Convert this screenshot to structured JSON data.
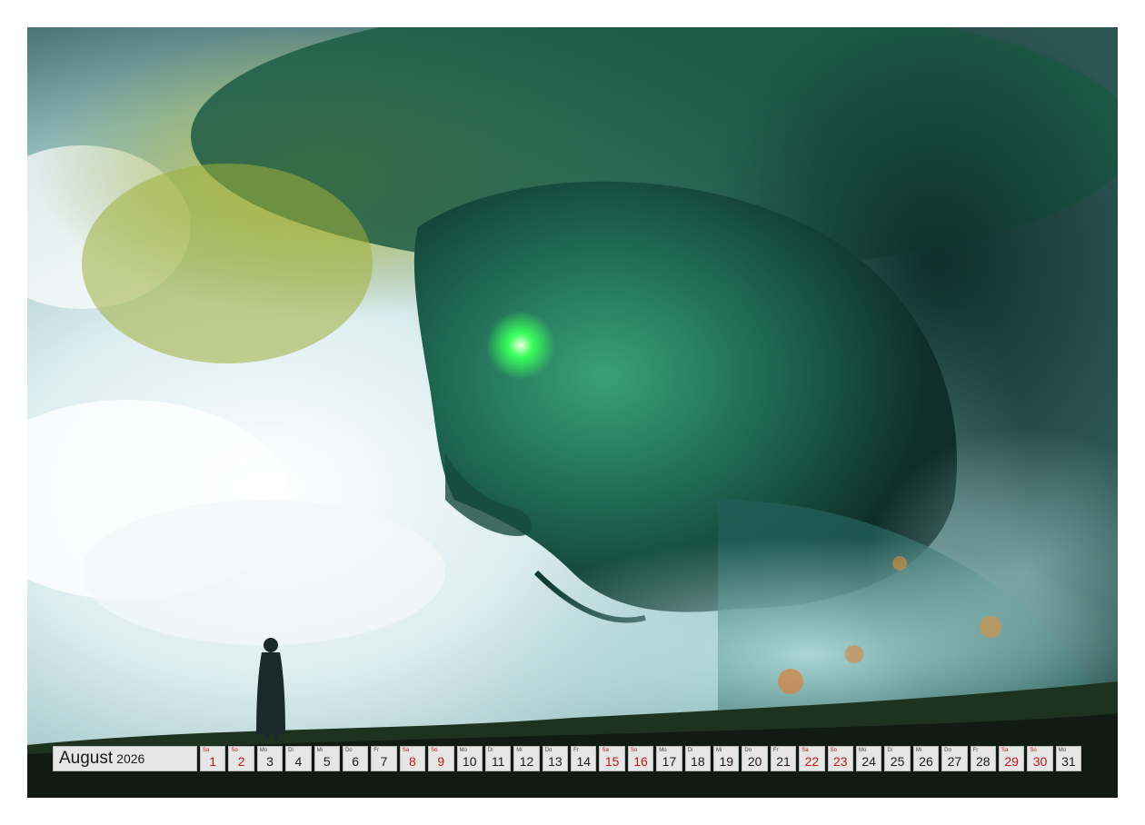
{
  "calendar": {
    "month": "August",
    "year": "2026",
    "days": [
      {
        "wd": "Sa",
        "d": "1",
        "we": true
      },
      {
        "wd": "So",
        "d": "2",
        "we": true
      },
      {
        "wd": "Mo",
        "d": "3"
      },
      {
        "wd": "Di",
        "d": "4"
      },
      {
        "wd": "Mi",
        "d": "5"
      },
      {
        "wd": "Do",
        "d": "6"
      },
      {
        "wd": "Fr",
        "d": "7"
      },
      {
        "wd": "Sa",
        "d": "8",
        "we": true
      },
      {
        "wd": "So",
        "d": "9",
        "we": true
      },
      {
        "wd": "Mo",
        "d": "10"
      },
      {
        "wd": "Di",
        "d": "11"
      },
      {
        "wd": "Mi",
        "d": "12"
      },
      {
        "wd": "Do",
        "d": "13"
      },
      {
        "wd": "Fr",
        "d": "14"
      },
      {
        "wd": "Sa",
        "d": "15",
        "we": true
      },
      {
        "wd": "So",
        "d": "16",
        "we": true
      },
      {
        "wd": "Mo",
        "d": "17"
      },
      {
        "wd": "Di",
        "d": "18"
      },
      {
        "wd": "Mi",
        "d": "19"
      },
      {
        "wd": "Do",
        "d": "20"
      },
      {
        "wd": "Fr",
        "d": "21"
      },
      {
        "wd": "Sa",
        "d": "22",
        "we": true
      },
      {
        "wd": "So",
        "d": "23",
        "we": true
      },
      {
        "wd": "Mo",
        "d": "24"
      },
      {
        "wd": "Di",
        "d": "25"
      },
      {
        "wd": "Mi",
        "d": "26"
      },
      {
        "wd": "Do",
        "d": "27"
      },
      {
        "wd": "Fr",
        "d": "28"
      },
      {
        "wd": "Sa",
        "d": "29",
        "we": true
      },
      {
        "wd": "So",
        "d": "30",
        "we": true
      },
      {
        "wd": "Mo",
        "d": "31"
      }
    ]
  },
  "colors": {
    "weekend": "#c01818",
    "eye_glow": "#39ff5a",
    "foliage_yellow": "#c9c23a",
    "foliage_green": "#1f6a4c"
  },
  "artwork": {
    "icon": "tree-giant-face-illustration"
  }
}
